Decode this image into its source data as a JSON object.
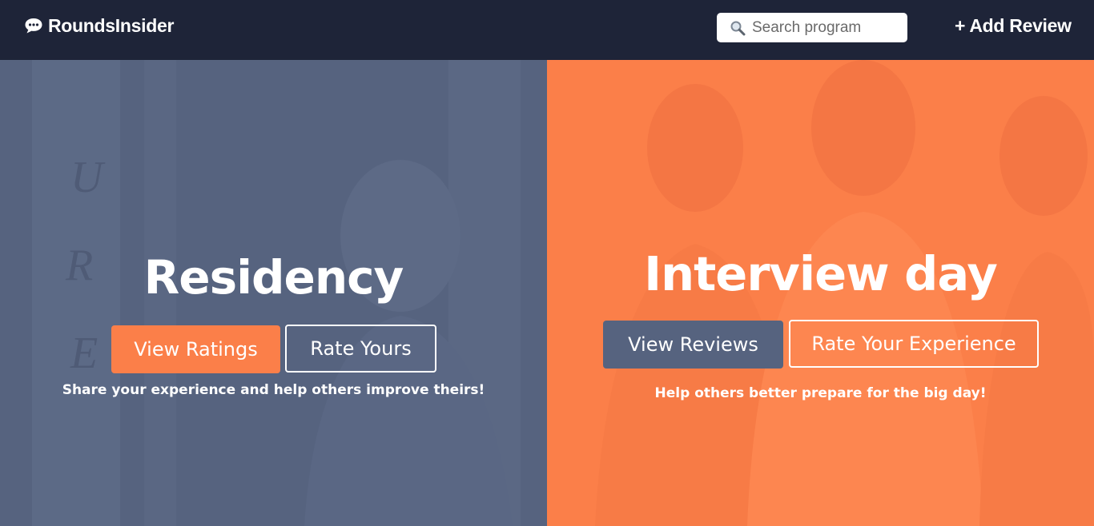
{
  "navbar": {
    "brand": "RoundsInsider",
    "brand_icon": "speech-bubble-icon",
    "search_icon": "magnifier-icon",
    "search_placeholder": "Search program",
    "add_review": "+ Add Review",
    "background": "#1e2438"
  },
  "residency": {
    "heading": "Residency",
    "view_button": "View Ratings",
    "rate_button": "Rate Yours",
    "tagline": "Share your experience and help others improve theirs!",
    "background": "#56637f"
  },
  "interview": {
    "heading": "Interview day",
    "view_button": "View Reviews",
    "rate_button": "Rate Your Experience",
    "tagline": "Help others better prepare for the big day!",
    "background": "#fb7f49"
  }
}
